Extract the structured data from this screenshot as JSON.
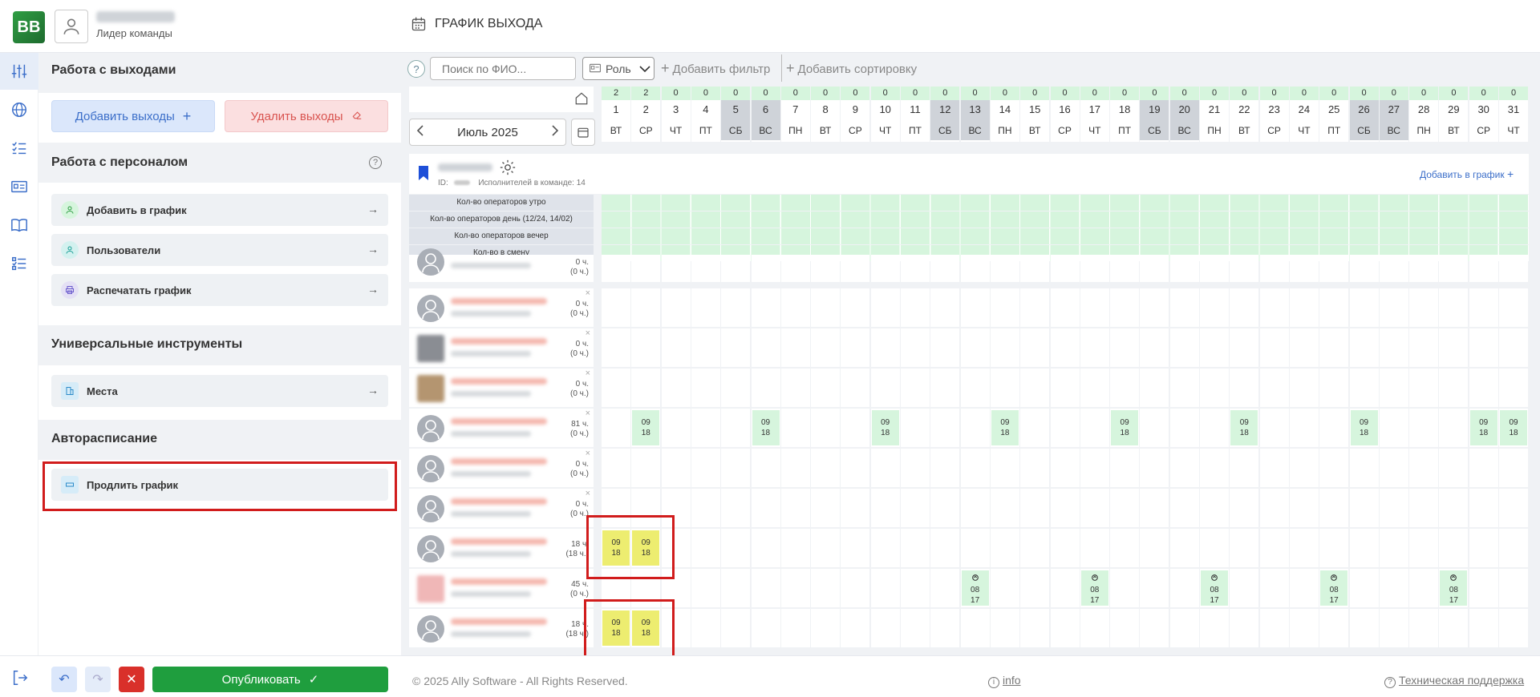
{
  "header": {
    "logo_text": "BB",
    "user_role": "Лидер команды",
    "page_title": "ГРАФИК ВЫХОДА"
  },
  "panel": {
    "sec1_title": "Работа с выходами",
    "add_label": "Добавить выходы",
    "delete_label": "Удалить выходы",
    "sec2_title": "Работа с персоналом",
    "items_personnel": [
      {
        "label": "Добавить в график"
      },
      {
        "label": "Пользователи"
      },
      {
        "label": "Распечатать график"
      }
    ],
    "sec3_title": "Универсальные инструменты",
    "places_label": "Места",
    "sec4_title": "Авторасписание",
    "extend_label": "Продлить график"
  },
  "toolbar": {
    "help": "?",
    "search_placeholder": "Поиск по ФИО...",
    "role_label": "Роль",
    "add_filter": "Добавить фильтр",
    "add_sort": "Добавить сортировку"
  },
  "calendar": {
    "month": "Июль 2025",
    "days": [
      {
        "n": "1",
        "d": "ВТ",
        "c": "2",
        "we": false
      },
      {
        "n": "2",
        "d": "СР",
        "c": "2",
        "we": false
      },
      {
        "n": "3",
        "d": "ЧТ",
        "c": "0",
        "we": false
      },
      {
        "n": "4",
        "d": "ПТ",
        "c": "0",
        "we": false
      },
      {
        "n": "5",
        "d": "СБ",
        "c": "0",
        "we": true
      },
      {
        "n": "6",
        "d": "ВС",
        "c": "0",
        "we": true
      },
      {
        "n": "7",
        "d": "ПН",
        "c": "0",
        "we": false
      },
      {
        "n": "8",
        "d": "ВТ",
        "c": "0",
        "we": false
      },
      {
        "n": "9",
        "d": "СР",
        "c": "0",
        "we": false
      },
      {
        "n": "10",
        "d": "ЧТ",
        "c": "0",
        "we": false
      },
      {
        "n": "11",
        "d": "ПТ",
        "c": "0",
        "we": false
      },
      {
        "n": "12",
        "d": "СБ",
        "c": "0",
        "we": true
      },
      {
        "n": "13",
        "d": "ВС",
        "c": "0",
        "we": true
      },
      {
        "n": "14",
        "d": "ПН",
        "c": "0",
        "we": false
      },
      {
        "n": "15",
        "d": "ВТ",
        "c": "0",
        "we": false
      },
      {
        "n": "16",
        "d": "СР",
        "c": "0",
        "we": false
      },
      {
        "n": "17",
        "d": "ЧТ",
        "c": "0",
        "we": false
      },
      {
        "n": "18",
        "d": "ПТ",
        "c": "0",
        "we": false
      },
      {
        "n": "19",
        "d": "СБ",
        "c": "0",
        "we": true
      },
      {
        "n": "20",
        "d": "ВС",
        "c": "0",
        "we": true
      },
      {
        "n": "21",
        "d": "ПН",
        "c": "0",
        "we": false
      },
      {
        "n": "22",
        "d": "ВТ",
        "c": "0",
        "we": false
      },
      {
        "n": "23",
        "d": "СР",
        "c": "0",
        "we": false
      },
      {
        "n": "24",
        "d": "ЧТ",
        "c": "0",
        "we": false
      },
      {
        "n": "25",
        "d": "ПТ",
        "c": "0",
        "we": false
      },
      {
        "n": "26",
        "d": "СБ",
        "c": "0",
        "we": true
      },
      {
        "n": "27",
        "d": "ВС",
        "c": "0",
        "we": true
      },
      {
        "n": "28",
        "d": "ПН",
        "c": "0",
        "we": false
      },
      {
        "n": "29",
        "d": "ВТ",
        "c": "0",
        "we": false
      },
      {
        "n": "30",
        "d": "СР",
        "c": "0",
        "we": false
      },
      {
        "n": "31",
        "d": "ЧТ",
        "c": "0",
        "we": false
      }
    ]
  },
  "team": {
    "id_label": "ID:",
    "members_label": "Исполнителей в команде: 14",
    "add_to_graph": "Добавить в график"
  },
  "summary_rows": [
    "Кол-во операторов утро",
    "Кол-во операторов день (12/24, 14/02)",
    "Кол-во операторов вечер",
    "Кол-во в смену"
  ],
  "employees": [
    {
      "h1": "0 ч.",
      "h2": "(0 ч.)",
      "photo": false,
      "shifts": []
    },
    {
      "h1": "0 ч.",
      "h2": "(0 ч.)",
      "photo": false,
      "shifts": []
    },
    {
      "h1": "0 ч.",
      "h2": "(0 ч.)",
      "photo": true,
      "shifts": []
    },
    {
      "h1": "0 ч.",
      "h2": "(0 ч.)",
      "photo": true,
      "shifts": []
    },
    {
      "h1": "81 ч.",
      "h2": "(0 ч.)",
      "photo": false,
      "shifts": [
        {
          "day": 2,
          "t1": "09",
          "t2": "18",
          "kind": "g"
        },
        {
          "day": 6,
          "t1": "09",
          "t2": "18",
          "kind": "g"
        },
        {
          "day": 10,
          "t1": "09",
          "t2": "18",
          "kind": "g"
        },
        {
          "day": 14,
          "t1": "09",
          "t2": "18",
          "kind": "g"
        },
        {
          "day": 18,
          "t1": "09",
          "t2": "18",
          "kind": "g"
        },
        {
          "day": 22,
          "t1": "09",
          "t2": "18",
          "kind": "g"
        },
        {
          "day": 26,
          "t1": "09",
          "t2": "18",
          "kind": "g"
        },
        {
          "day": 30,
          "t1": "09",
          "t2": "18",
          "kind": "g"
        },
        {
          "day": 31,
          "t1": "09",
          "t2": "18",
          "kind": "g"
        }
      ]
    },
    {
      "h1": "0 ч.",
      "h2": "(0 ч.)",
      "photo": false,
      "shifts": []
    },
    {
      "h1": "0 ч.",
      "h2": "(0 ч.)",
      "photo": false,
      "shifts": []
    },
    {
      "h1": "18 ч.",
      "h2": "(18 ч.)",
      "photo": false,
      "shifts": [
        {
          "day": 1,
          "t1": "09",
          "t2": "18",
          "kind": "y"
        },
        {
          "day": 2,
          "t1": "09",
          "t2": "18",
          "kind": "y"
        }
      ]
    },
    {
      "h1": "45 ч.",
      "h2": "(0 ч.)",
      "photo": true,
      "shifts": [
        {
          "day": 13,
          "t1": "08",
          "t2": "17",
          "kind": "g"
        },
        {
          "day": 17,
          "t1": "08",
          "t2": "17",
          "kind": "g"
        },
        {
          "day": 21,
          "t1": "08",
          "t2": "17",
          "kind": "g"
        },
        {
          "day": 25,
          "t1": "08",
          "t2": "17",
          "kind": "g"
        },
        {
          "day": 29,
          "t1": "08",
          "t2": "17",
          "kind": "g"
        }
      ]
    },
    {
      "h1": "18 ч.",
      "h2": "(18 ч.)",
      "photo": false,
      "shifts": [
        {
          "day": 1,
          "t1": "09",
          "t2": "18",
          "kind": "y"
        },
        {
          "day": 2,
          "t1": "09",
          "t2": "18",
          "kind": "y"
        }
      ]
    }
  ],
  "bottom": {
    "publish_label": "Опубликовать",
    "copyright": "© 2025 Ally Software - All Rights Reserved.",
    "info": "info",
    "support": "Техническая поддержка"
  },
  "colors": {
    "accent_blue": "#3b6ec9",
    "publish_green": "#1f9e3e",
    "shift_green": "#d6f5dd",
    "shift_yellow": "#eded70",
    "highlight_red": "#d11c1c"
  }
}
